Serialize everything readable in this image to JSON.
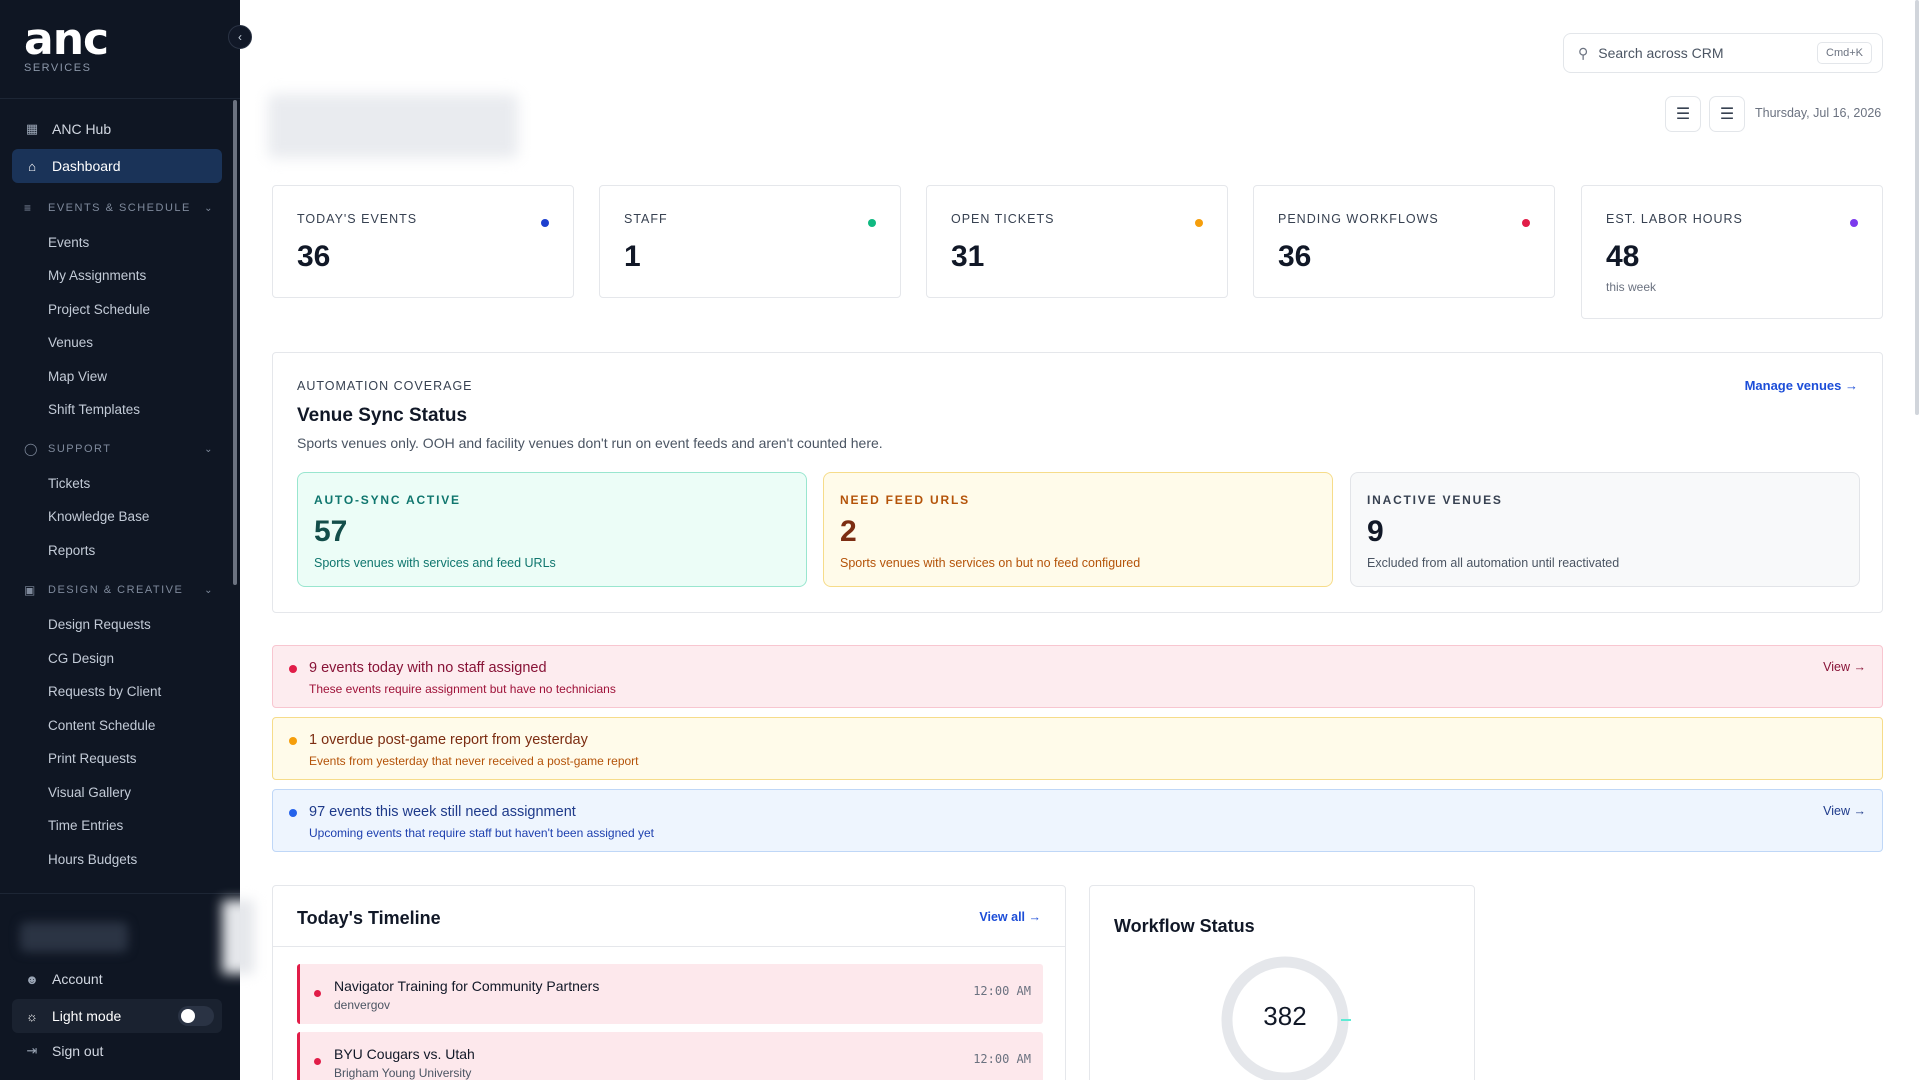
{
  "brand": {
    "logo_text": "anc",
    "tagline": "SERVICES"
  },
  "sidebar": {
    "hub": "ANC Hub",
    "dashboard": "Dashboard",
    "sections": [
      {
        "title": "EVENTS & SCHEDULE",
        "items": [
          "Events",
          "My Assignments",
          "Project Schedule",
          "Venues",
          "Map View",
          "Shift Templates"
        ]
      },
      {
        "title": "SUPPORT",
        "items": [
          "Tickets",
          "Knowledge Base",
          "Reports"
        ]
      },
      {
        "title": "DESIGN & CREATIVE",
        "items": [
          "Design Requests",
          "CG Design",
          "Requests by Client",
          "Content Schedule",
          "Print Requests",
          "Visual Gallery",
          "Time Entries",
          "Hours Budgets"
        ]
      }
    ],
    "bottom": {
      "account": "Account",
      "light_mode": "Light mode",
      "sign_out": "Sign out",
      "light_mode_on": false
    }
  },
  "header": {
    "search_placeholder": "Search across CRM",
    "search_shortcut": "Cmd+K",
    "date": "Thursday, Jul 16, 2026"
  },
  "stats": [
    {
      "label": "TODAY'S EVENTS",
      "value": "36",
      "sub": "",
      "color": "#1d3fcf"
    },
    {
      "label": "STAFF",
      "value": "1",
      "sub": "",
      "color": "#10b981"
    },
    {
      "label": "OPEN TICKETS",
      "value": "31",
      "sub": "",
      "color": "#f59e0b"
    },
    {
      "label": "PENDING WORKFLOWS",
      "value": "36",
      "sub": "",
      "color": "#e11d48"
    },
    {
      "label": "EST. LABOR HOURS",
      "value": "48",
      "sub": "this week",
      "color": "#7c3aed"
    }
  ],
  "venue_sync": {
    "eyebrow": "AUTOMATION COVERAGE",
    "title": "Venue Sync Status",
    "description": "Sports venues only. OOH and facility venues don't run on event feeds and aren't counted here.",
    "link": "Manage venues →",
    "cards": [
      {
        "label": "AUTO-SYNC ACTIVE",
        "value": "57",
        "desc": "Sports venues with services and feed URLs"
      },
      {
        "label": "NEED FEED URLS",
        "value": "2",
        "desc": "Sports venues with services on but no feed configured"
      },
      {
        "label": "INACTIVE VENUES",
        "value": "9",
        "desc": "Excluded from all automation until reactivated"
      }
    ]
  },
  "alerts": [
    {
      "title": "9 events today with no staff assigned",
      "desc": "These events require assignment but have no technicians",
      "link": "View →"
    },
    {
      "title": "1 overdue post-game report from yesterday",
      "desc": "Events from yesterday that never received a post-game report",
      "link": ""
    },
    {
      "title": "97 events this week still need assignment",
      "desc": "Upcoming events that require staff but haven't been assigned yet",
      "link": "View →"
    }
  ],
  "timeline": {
    "title": "Today's Timeline",
    "link": "View all →",
    "items": [
      {
        "name": "Navigator Training for Community Partners",
        "org": "denvergov",
        "time": "12:00 AM"
      },
      {
        "name": "BYU Cougars vs. Utah",
        "org": "Brigham Young University",
        "time": "12:00 AM"
      }
    ]
  },
  "workflow": {
    "title": "Workflow Status",
    "total": "382"
  }
}
